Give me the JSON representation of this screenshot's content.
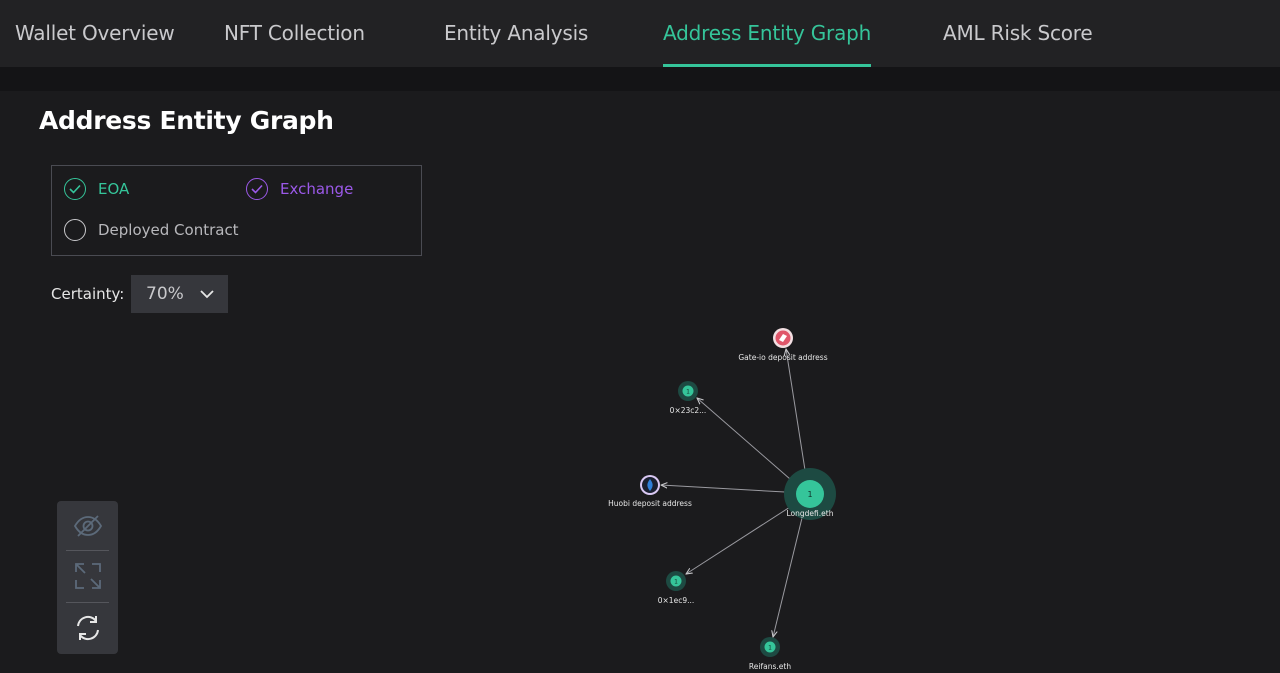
{
  "tabs": [
    {
      "label": "Wallet Overview"
    },
    {
      "label": "NFT Collection"
    },
    {
      "label": "Entity Analysis"
    },
    {
      "label": "Address Entity Graph",
      "active": true
    },
    {
      "label": "AML Risk Score"
    }
  ],
  "page_title": "Address Entity Graph",
  "legend": {
    "eoa": {
      "label": "EOA",
      "checked": true,
      "color": "#35c59a"
    },
    "exchange": {
      "label": "Exchange",
      "checked": true,
      "color": "#9b59e8"
    },
    "contract": {
      "label": "Deployed Contract",
      "checked": false
    }
  },
  "certainty": {
    "label": "Certainty:",
    "value": "70%"
  },
  "toolbar": {
    "icons": [
      "eye-off-icon",
      "expand-icon",
      "refresh-icon"
    ]
  },
  "graph": {
    "center": {
      "label": "Longdefi.eth",
      "count": "1"
    },
    "nodes": [
      {
        "id": "gate",
        "label": "Gate-io deposit address",
        "type": "exchange"
      },
      {
        "id": "n23c2",
        "label": "0×23c2...",
        "count": "1",
        "type": "eoa"
      },
      {
        "id": "huobi",
        "label": "Huobi deposit address",
        "type": "exchange"
      },
      {
        "id": "n1ec9",
        "label": "0×1ec9...",
        "count": "1",
        "type": "eoa"
      },
      {
        "id": "reifans",
        "label": "Reifans.eth",
        "count": "1",
        "type": "eoa"
      }
    ]
  },
  "colors": {
    "accent": "#35c59a",
    "exchange": "#9b59e8",
    "gate_logo": "#e0566a"
  }
}
